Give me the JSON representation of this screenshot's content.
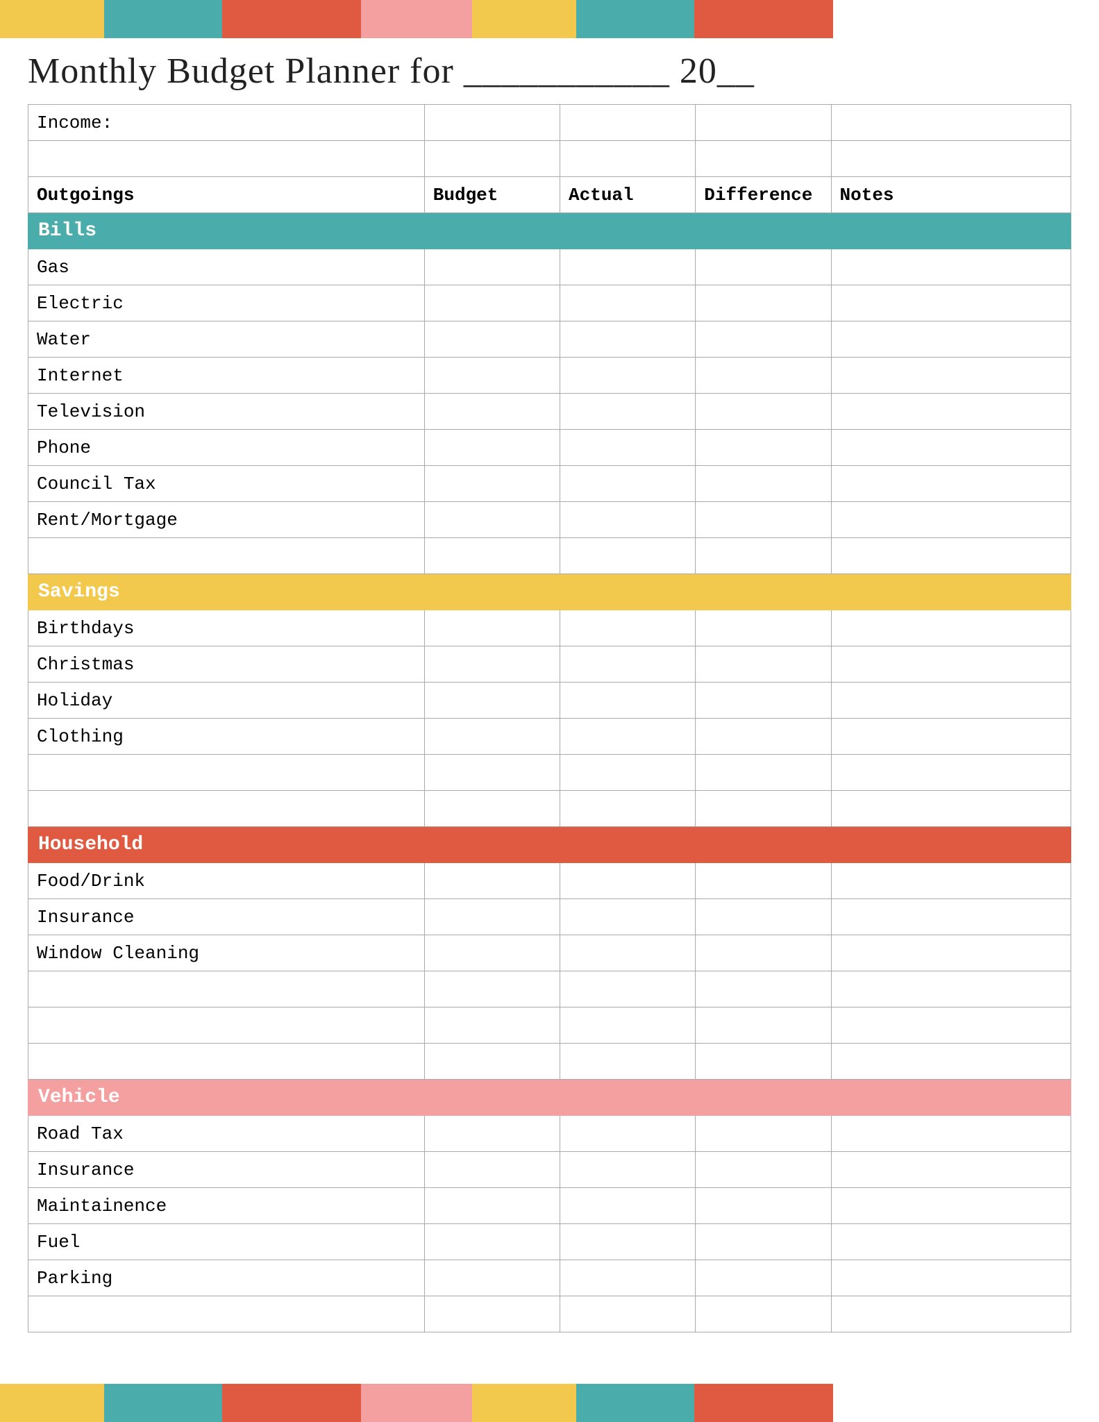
{
  "title": "Monthly Budget Planner for ___________ 20__",
  "deco": {
    "colors": [
      "#F2C94C",
      "#4AACAB",
      "#E05A42",
      "#F4A0A0",
      "#F2C94C",
      "#4AACAB",
      "#E05A42"
    ]
  },
  "table": {
    "income_label": "Income:",
    "headers": {
      "col1": "Outgoings",
      "col2": "Budget",
      "col3": "Actual",
      "col4": "Difference",
      "col5": "Notes"
    },
    "sections": [
      {
        "name": "Bills",
        "color": "#4AACAB",
        "rows": [
          "Gas",
          "Electric",
          "Water",
          "Internet",
          "Television",
          "Phone",
          "Council Tax",
          "Rent/Mortgage",
          ""
        ]
      },
      {
        "name": "Savings",
        "color": "#F2C94C",
        "rows": [
          "Birthdays",
          "Christmas",
          "Holiday",
          "Clothing",
          "",
          ""
        ]
      },
      {
        "name": "Household",
        "color": "#E05A42",
        "rows": [
          "Food/Drink",
          "Insurance",
          "Window Cleaning",
          "",
          "",
          ""
        ]
      },
      {
        "name": "Vehicle",
        "color": "#F4A0A0",
        "rows": [
          "Road Tax",
          "Insurance",
          "Maintainence",
          "Fuel",
          "Parking",
          ""
        ]
      }
    ]
  }
}
